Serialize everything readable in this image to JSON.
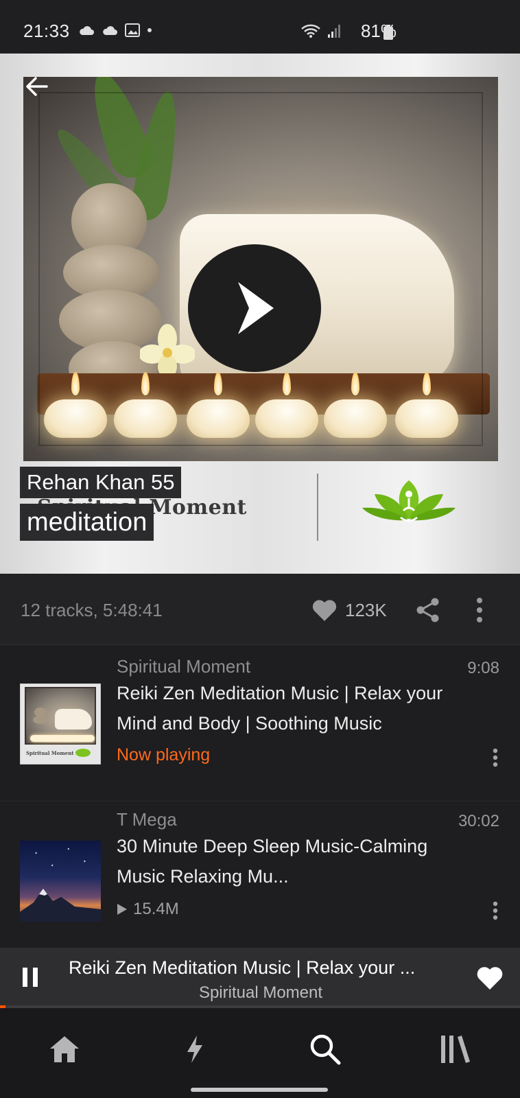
{
  "status_bar": {
    "time": "21:33",
    "battery": "81%"
  },
  "playlist": {
    "artist": "Rehan Khan 55",
    "title": "meditation",
    "art_brand_text": "Spiritual Moment",
    "track_info": "12 tracks, 5:48:41",
    "likes": "123K"
  },
  "tracks": [
    {
      "artist": "Spiritual Moment",
      "duration": "9:08",
      "title": "Reiki Zen Meditation Music | Relax your Mind and Body | Soothing Music",
      "status": "Now playing",
      "thumb_brand_text": "Spiritual Moment"
    },
    {
      "artist": "T Mega",
      "duration": "30:02",
      "title": "30 Minute Deep Sleep Music-Calming Music Relaxing Mu...",
      "plays": "15.4M"
    }
  ],
  "mini_player": {
    "title": "Reiki Zen Meditation Music | Relax your ...",
    "artist": "Spiritual Moment",
    "progress": 0.01
  },
  "nav": [
    "home-icon",
    "stream-icon",
    "search-icon",
    "library-icon"
  ],
  "colors": {
    "accent": "#ff5500",
    "now_playing": "#ff6a1a",
    "background": "#1e1d20"
  }
}
